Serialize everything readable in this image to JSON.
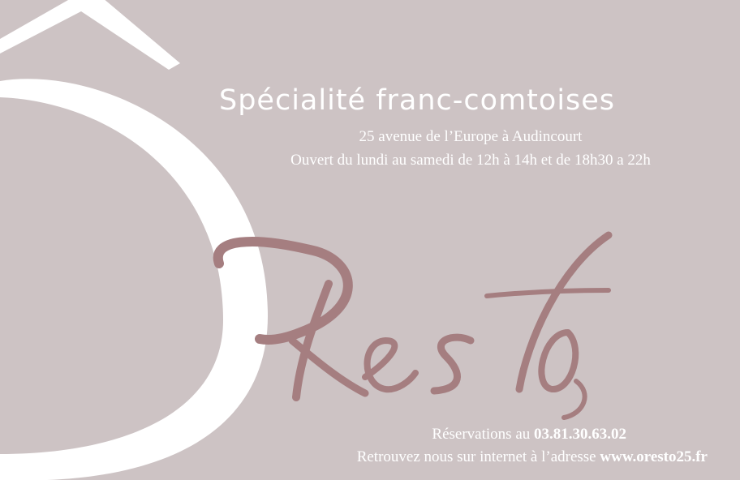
{
  "brand": {
    "logo_letter": "Ô",
    "script_name": "Resto"
  },
  "headline": "Spécialité franc-comtoises",
  "info": {
    "address": "25 avenue de l’Europe à Audincourt",
    "hours": "Ouvert du lundi au samedi de 12h à 14h et de 18h30 a 22h"
  },
  "contact": {
    "reservations_prefix": "Réservations au ",
    "phone": "03.81.30.63.02",
    "web_prefix": "Retrouvez nous sur internet à l’adresse ",
    "website": "www.oresto25.fr"
  },
  "colors": {
    "background": "#cdc3c4",
    "logo": "#ffffff",
    "script": "#a57e80",
    "text": "#ffffff"
  }
}
